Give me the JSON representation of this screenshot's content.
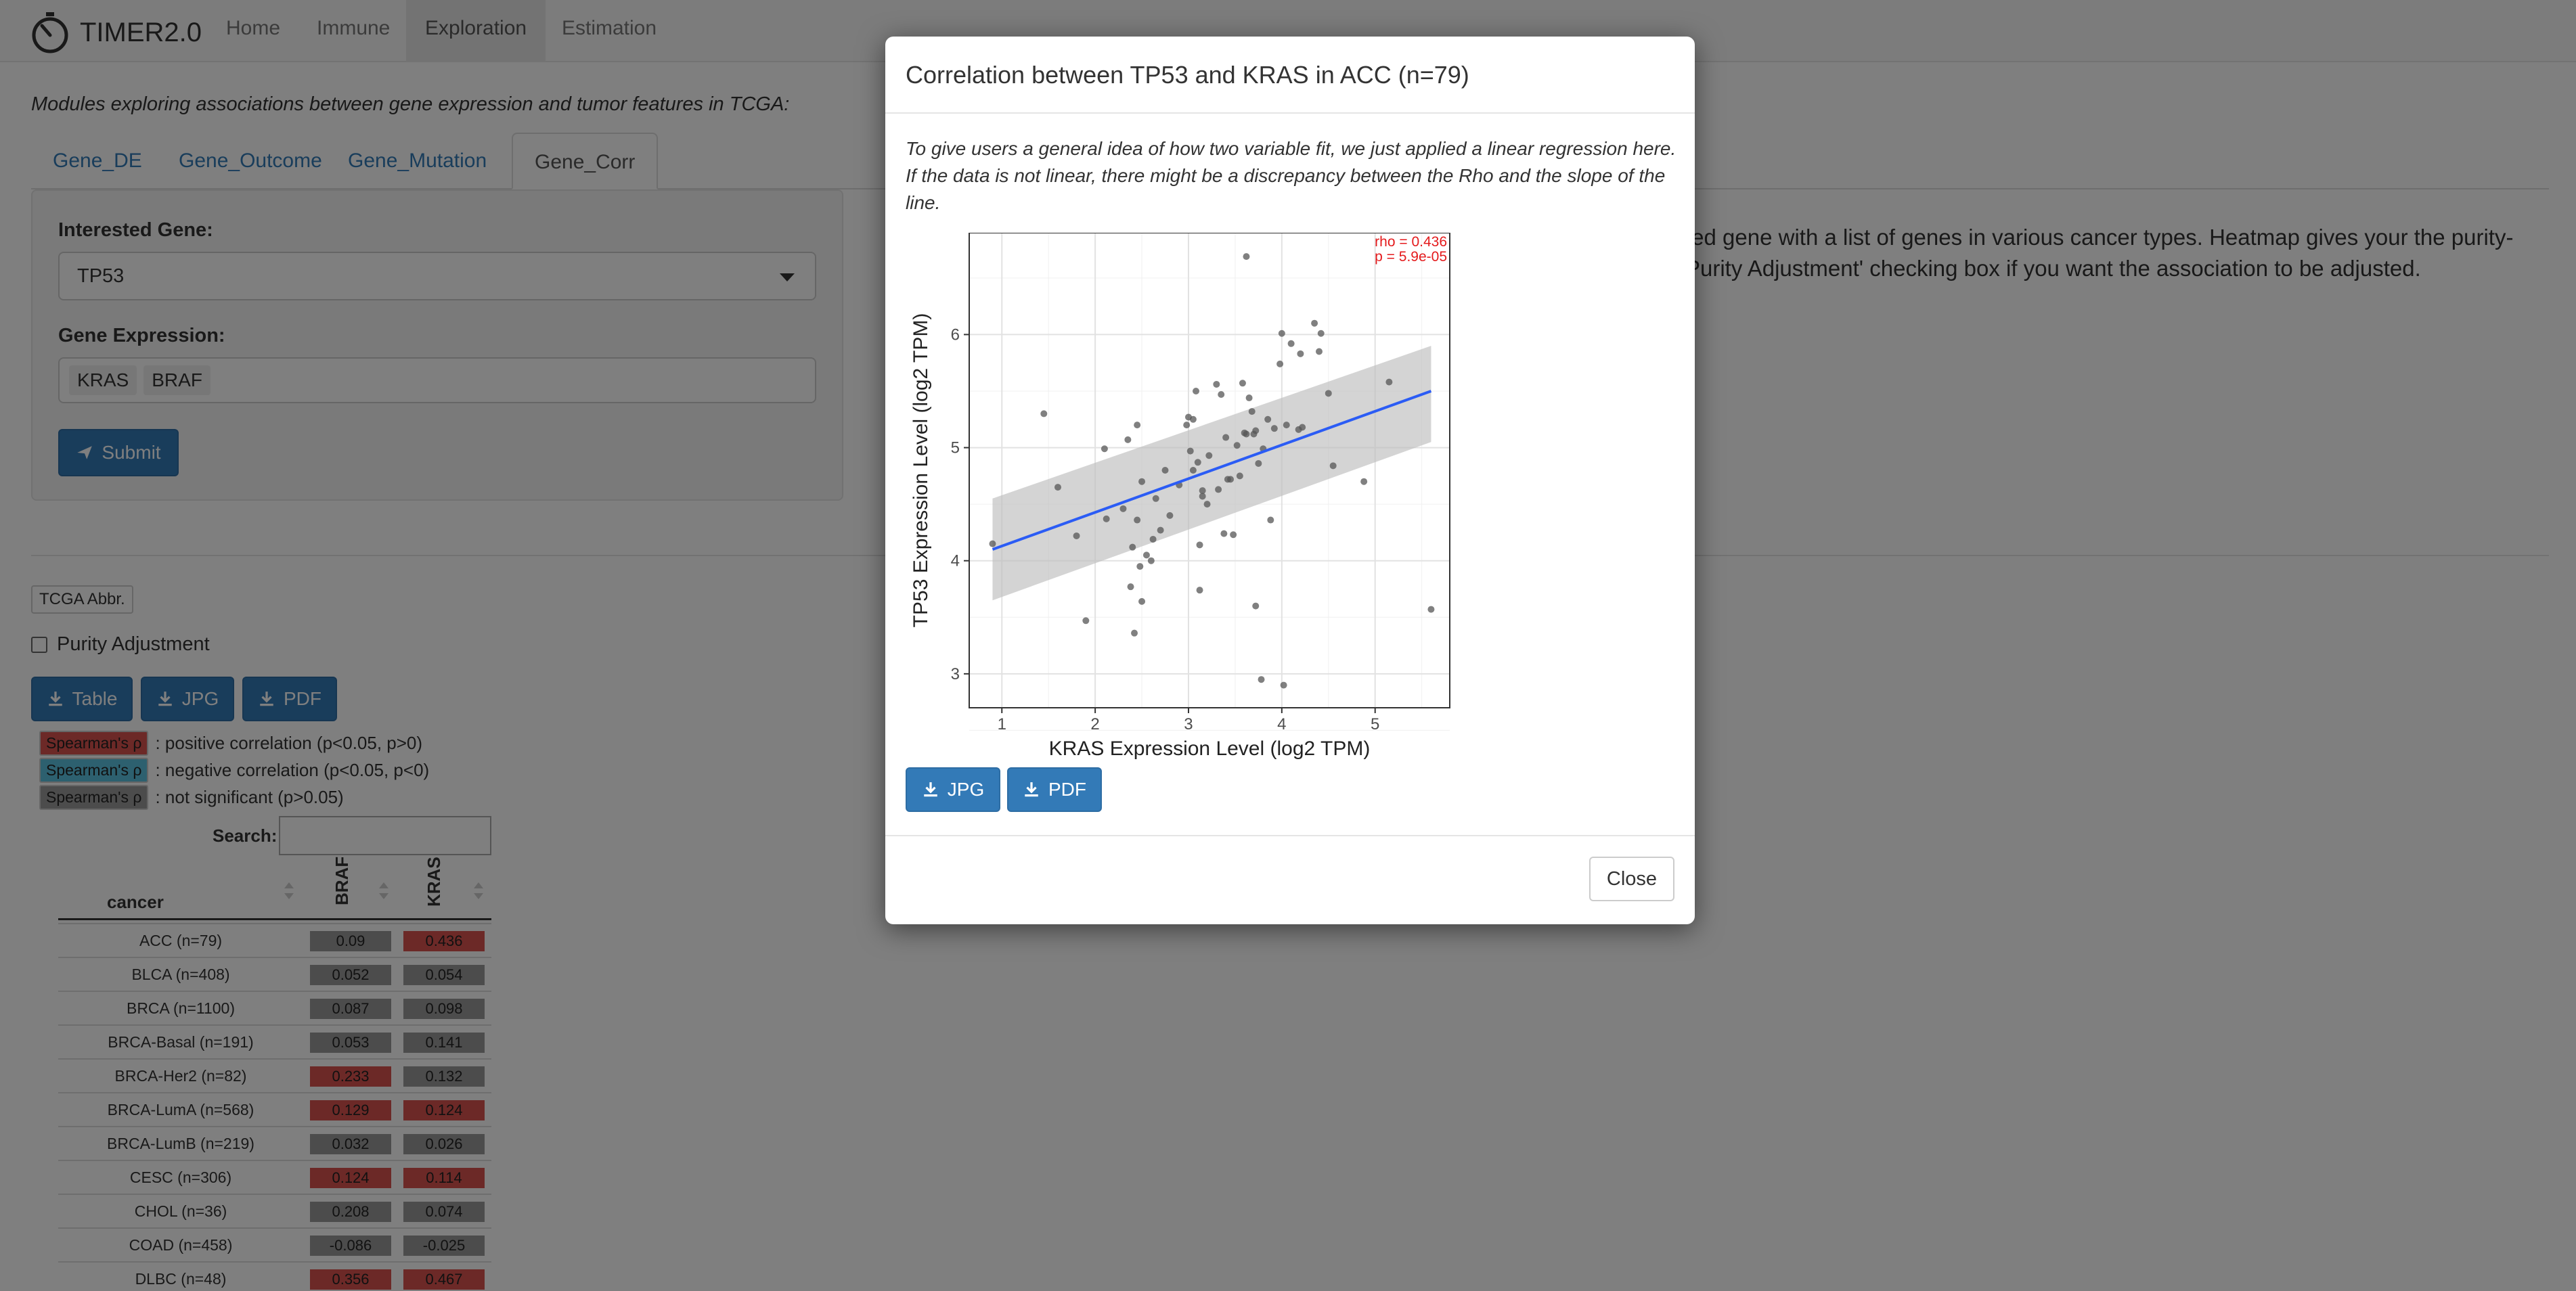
{
  "brand": {
    "name": "TIMER2.0"
  },
  "nav": {
    "home": "Home",
    "immune": "Immune",
    "exploration": "Exploration",
    "estimation": "Estimation"
  },
  "lead": "Modules exploring associations between gene expression and tumor features in TCGA:",
  "tabs": [
    "Gene_DE",
    "Gene_Outcome",
    "Gene_Mutation",
    "Gene_Corr"
  ],
  "form": {
    "gene_label": "Interested Gene:",
    "gene_value": "TP53",
    "expr_label": "Gene Expression:",
    "expr_tags": [
      "KRAS",
      "BRAF"
    ],
    "submit": "Submit"
  },
  "info": {
    "line1": "ted gene with a list of genes in various cancer types. Heatmap gives your the purity-",
    "line2": "Purity Adjustment' checking box if you want the association to be adjusted."
  },
  "controls": {
    "abbr": "TCGA Abbr.",
    "purity": "Purity Adjustment",
    "table_btn": "Table",
    "jpg_btn": "JPG",
    "pdf_btn": "PDF"
  },
  "legend": [
    {
      "swatch": "Spearman's ρ",
      "text": ": positive correlation (p<0.05, p>0)",
      "color": "#d9534f"
    },
    {
      "swatch": "Spearman's ρ",
      "text": ": negative correlation (p<0.05, p<0)",
      "color": "#5bc0de"
    },
    {
      "swatch": "Spearman's ρ",
      "text": ": not significant (p>0.05)",
      "color": "#999999"
    }
  ],
  "search_label": "Search:",
  "table": {
    "headers": [
      "cancer",
      "BRAF",
      "KRAS"
    ],
    "rows": [
      {
        "cancer": "ACC (n=79)",
        "braf": "0.09",
        "kras": "0.436",
        "braf_sig": "ns",
        "kras_sig": "pos"
      },
      {
        "cancer": "BLCA (n=408)",
        "braf": "0.052",
        "kras": "0.054",
        "braf_sig": "ns",
        "kras_sig": "ns"
      },
      {
        "cancer": "BRCA (n=1100)",
        "braf": "0.087",
        "kras": "0.098",
        "braf_sig": "ns",
        "kras_sig": "ns"
      },
      {
        "cancer": "BRCA-Basal (n=191)",
        "braf": "0.053",
        "kras": "0.141",
        "braf_sig": "ns",
        "kras_sig": "ns"
      },
      {
        "cancer": "BRCA-Her2 (n=82)",
        "braf": "0.233",
        "kras": "0.132",
        "braf_sig": "pos",
        "kras_sig": "ns"
      },
      {
        "cancer": "BRCA-LumA (n=568)",
        "braf": "0.129",
        "kras": "0.124",
        "braf_sig": "pos",
        "kras_sig": "pos"
      },
      {
        "cancer": "BRCA-LumB (n=219)",
        "braf": "0.032",
        "kras": "0.026",
        "braf_sig": "ns",
        "kras_sig": "ns"
      },
      {
        "cancer": "CESC (n=306)",
        "braf": "0.124",
        "kras": "0.114",
        "braf_sig": "pos",
        "kras_sig": "pos"
      },
      {
        "cancer": "CHOL (n=36)",
        "braf": "0.208",
        "kras": "0.074",
        "braf_sig": "ns",
        "kras_sig": "ns"
      },
      {
        "cancer": "COAD (n=458)",
        "braf": "-0.086",
        "kras": "-0.025",
        "braf_sig": "ns",
        "kras_sig": "ns"
      },
      {
        "cancer": "DLBC (n=48)",
        "braf": "0.356",
        "kras": "0.467",
        "braf_sig": "pos",
        "kras_sig": "pos"
      }
    ]
  },
  "sig_colors": {
    "pos": "#d9534f",
    "neg": "#5bc0de",
    "ns": "#999999"
  },
  "modal": {
    "title": "Correlation between TP53 and KRAS in ACC (n=79)",
    "note": "To give users a general idea of how two variable fit, we just applied a linear regression here. If the data is not linear, there might be a discrepancy between the Rho and the slope of the line.",
    "jpg": "JPG",
    "pdf": "PDF",
    "close": "Close"
  },
  "chart_data": {
    "type": "scatter",
    "xlabel": "KRAS Expression Level (log2 TPM)",
    "ylabel": "TP53 Expression Level (log2 TPM)",
    "xlim": [
      0.65,
      5.8
    ],
    "ylim": [
      2.7,
      6.9
    ],
    "xticks": [
      1,
      2,
      3,
      4,
      5
    ],
    "yticks": [
      3,
      4,
      5,
      6
    ],
    "annotations": [
      "rho = 0.436",
      "p = 5.9e-05"
    ],
    "annotation_color": "#e41a1c",
    "fit": {
      "x": [
        0.9,
        5.6
      ],
      "y": [
        4.1,
        5.5
      ],
      "band_upper": [
        4.55,
        5.9
      ],
      "band_lower": [
        3.65,
        5.05
      ],
      "color": "#2b5cf5"
    },
    "points": [
      [
        0.9,
        4.15
      ],
      [
        1.45,
        5.3
      ],
      [
        1.6,
        4.65
      ],
      [
        1.8,
        4.22
      ],
      [
        1.9,
        3.47
      ],
      [
        2.1,
        4.99
      ],
      [
        2.12,
        4.37
      ],
      [
        2.3,
        4.46
      ],
      [
        2.35,
        5.07
      ],
      [
        2.38,
        3.77
      ],
      [
        2.4,
        4.12
      ],
      [
        2.42,
        3.36
      ],
      [
        2.45,
        4.36
      ],
      [
        2.45,
        5.2
      ],
      [
        2.48,
        3.95
      ],
      [
        2.5,
        3.64
      ],
      [
        2.5,
        4.7
      ],
      [
        2.55,
        4.05
      ],
      [
        2.6,
        4.0
      ],
      [
        2.62,
        4.19
      ],
      [
        2.65,
        4.55
      ],
      [
        2.7,
        4.27
      ],
      [
        2.75,
        4.8
      ],
      [
        2.8,
        4.4
      ],
      [
        2.9,
        4.67
      ],
      [
        2.98,
        5.2
      ],
      [
        3.0,
        5.27
      ],
      [
        3.02,
        4.97
      ],
      [
        3.05,
        4.8
      ],
      [
        3.05,
        5.25
      ],
      [
        3.08,
        5.5
      ],
      [
        3.1,
        4.87
      ],
      [
        3.12,
        3.74
      ],
      [
        3.12,
        4.14
      ],
      [
        3.15,
        4.62
      ],
      [
        3.15,
        4.57
      ],
      [
        3.2,
        4.5
      ],
      [
        3.22,
        4.93
      ],
      [
        3.3,
        5.56
      ],
      [
        3.32,
        4.63
      ],
      [
        3.35,
        5.47
      ],
      [
        3.38,
        4.24
      ],
      [
        3.4,
        5.09
      ],
      [
        3.42,
        4.72
      ],
      [
        3.45,
        4.72
      ],
      [
        3.48,
        4.23
      ],
      [
        3.52,
        5.02
      ],
      [
        3.55,
        4.75
      ],
      [
        3.58,
        5.57
      ],
      [
        3.6,
        5.13
      ],
      [
        3.62,
        5.12
      ],
      [
        3.62,
        6.69
      ],
      [
        3.65,
        5.44
      ],
      [
        3.68,
        5.32
      ],
      [
        3.7,
        5.12
      ],
      [
        3.72,
        5.15
      ],
      [
        3.72,
        3.6
      ],
      [
        3.75,
        4.86
      ],
      [
        3.78,
        2.95
      ],
      [
        3.8,
        4.99
      ],
      [
        3.85,
        5.25
      ],
      [
        3.88,
        4.36
      ],
      [
        3.92,
        5.17
      ],
      [
        3.98,
        5.74
      ],
      [
        4.0,
        6.01
      ],
      [
        4.02,
        2.9
      ],
      [
        4.05,
        5.2
      ],
      [
        4.1,
        5.92
      ],
      [
        4.18,
        5.16
      ],
      [
        4.2,
        5.83
      ],
      [
        4.22,
        5.18
      ],
      [
        4.35,
        6.1
      ],
      [
        4.4,
        5.85
      ],
      [
        4.42,
        6.01
      ],
      [
        4.5,
        5.48
      ],
      [
        4.55,
        4.84
      ],
      [
        4.88,
        4.7
      ],
      [
        5.15,
        5.58
      ],
      [
        5.6,
        3.57
      ]
    ]
  }
}
